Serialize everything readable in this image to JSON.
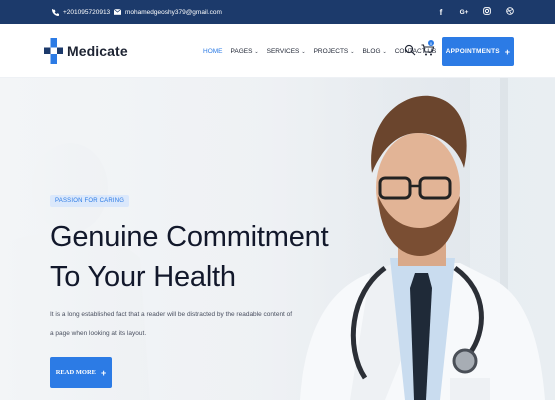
{
  "topbar": {
    "phone": "+201095720913",
    "email": "mohamedgeoshy379@gmail.com",
    "social_icons": [
      "facebook-icon",
      "google-plus-icon",
      "instagram-icon",
      "dribbble-icon"
    ]
  },
  "header": {
    "brand": "Medicate",
    "nav": [
      {
        "label": "HOME",
        "active": true,
        "dropdown": false
      },
      {
        "label": "PAGES",
        "active": false,
        "dropdown": true
      },
      {
        "label": "SERVICES",
        "active": false,
        "dropdown": true
      },
      {
        "label": "PROJECTS",
        "active": false,
        "dropdown": true
      },
      {
        "label": "BLOG",
        "active": false,
        "dropdown": true
      },
      {
        "label": "CONTACT US",
        "active": false,
        "dropdown": false
      }
    ],
    "cart_count": "0",
    "cta_label": "APPOINTMENTS",
    "cta_icon": "+"
  },
  "hero": {
    "tag": "PASSION FOR CARING",
    "title_line1": "Genuine Commitment",
    "title_line2": "To Your Health",
    "text": "It is a long established fact that a reader will be distracted by the readable content of a page when looking at its layout.",
    "button_label": "READ MORE",
    "button_icon": "+"
  },
  "colors": {
    "topbar_bg": "#1c3a6b",
    "accent": "#2c7be5",
    "tag_bg": "#dbe8fb"
  }
}
